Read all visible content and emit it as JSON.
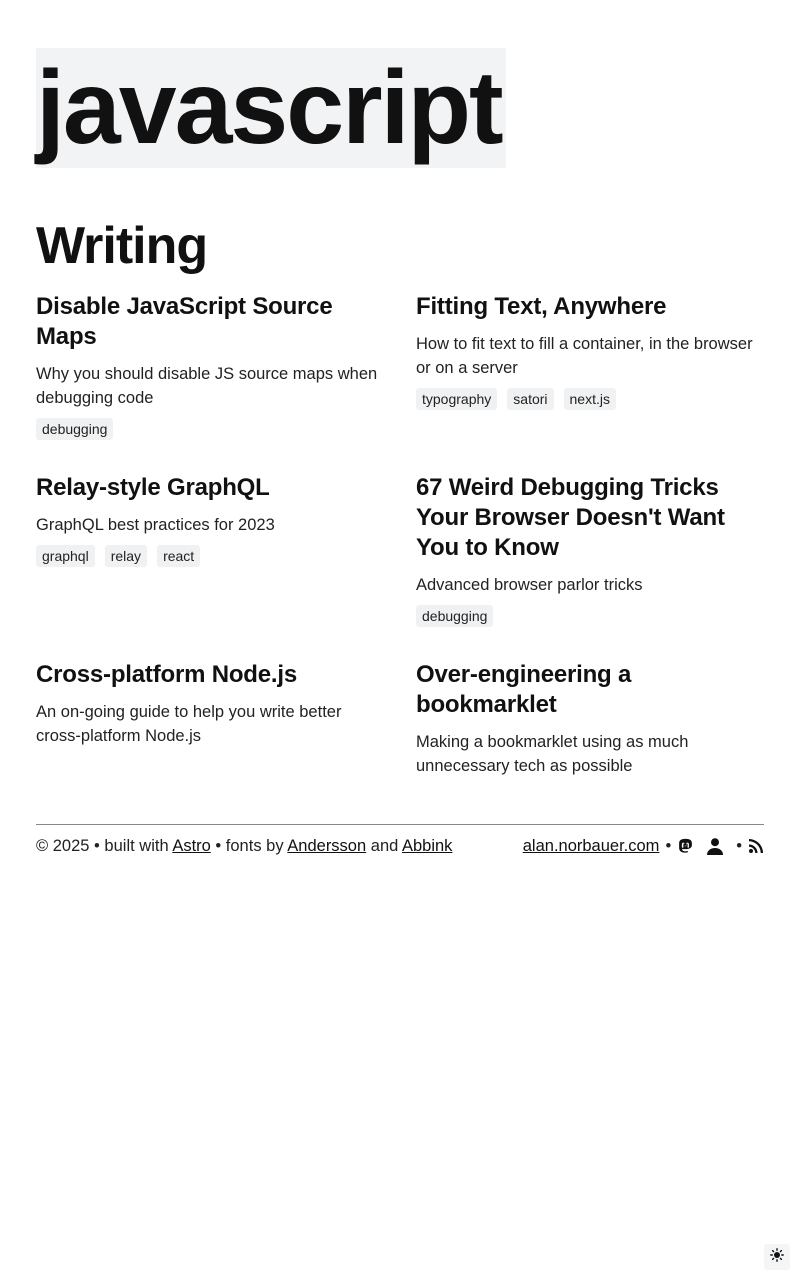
{
  "hero": {
    "text": "javascript"
  },
  "section": {
    "title": "Writing"
  },
  "posts": [
    {
      "title": "Disable JavaScript Source Maps",
      "description": "Why you should disable JS source maps when debugging code",
      "tags": [
        "debugging"
      ]
    },
    {
      "title": "Fitting Text, Anywhere",
      "description": "How to fit text to fill a container, in the browser or on a server",
      "tags": [
        "typography",
        "satori",
        "next.js"
      ]
    },
    {
      "title": "Relay-style GraphQL",
      "description": "GraphQL best practices for 2023",
      "tags": [
        "graphql",
        "relay",
        "react"
      ]
    },
    {
      "title": "67 Weird Debugging Tricks Your Browser Doesn't Want You to Know",
      "description": "Advanced browser parlor tricks",
      "tags": [
        "debugging"
      ]
    },
    {
      "title": "Cross-platform Node.js",
      "description": "An on-going guide to help you write better cross-platform Node.js",
      "tags": []
    },
    {
      "title": "Over-engineering a bookmarklet",
      "description": "Making a bookmarklet using as much unnecessary tech as possible",
      "tags": []
    }
  ],
  "footer": {
    "copyright": "© 2025",
    "sep": "•",
    "built_with": "built with",
    "astro": "Astro",
    "fonts_by": "fonts by",
    "andersson": "Andersson",
    "and": "and",
    "abbink": "Abbink",
    "site": "alan.norbauer.com",
    "icons": [
      "mastodon-icon",
      "person-icon",
      "rss-icon"
    ]
  },
  "theme_toggle": {
    "icon": "sun-icon"
  }
}
